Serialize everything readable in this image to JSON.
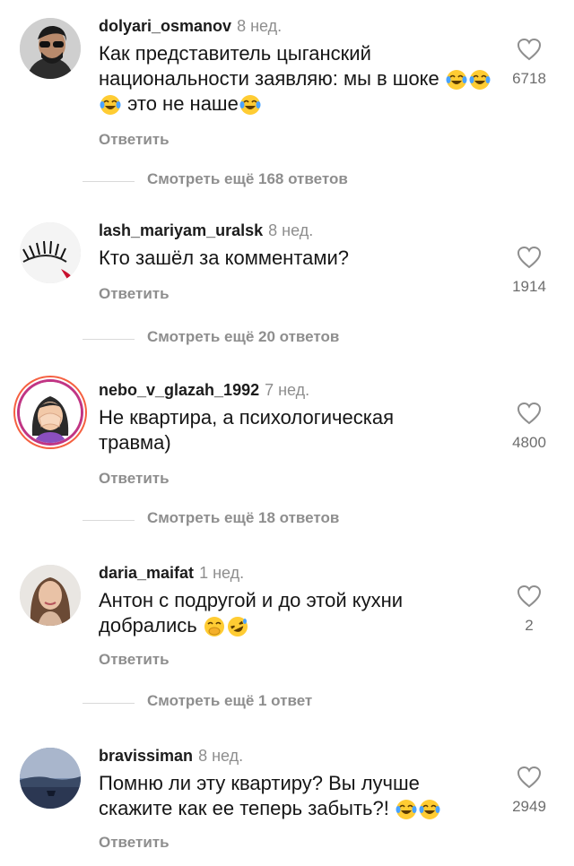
{
  "comments": [
    {
      "username": "dolyari_osmanov",
      "time": "8 нед.",
      "text": "Как представитель цыганский национальности заявляю: мы в шоке 😂😂😂 это не наше😂",
      "reply_label": "Ответить",
      "likes": "6718",
      "more_replies": "Смотреть ещё 168 ответов",
      "avatar_icon": "man-avatar"
    },
    {
      "username": "lash_mariyam_uralsk",
      "time": "8 нед.",
      "text": "Кто зашёл за комментами?",
      "reply_label": "Ответить",
      "likes": "1914",
      "more_replies": "Смотреть ещё 20 ответов",
      "avatar_icon": "eyelash-avatar"
    },
    {
      "username": "nebo_v_glazah_1992",
      "time": "7 нед.",
      "text": "Не квартира, а психологическая травма)",
      "reply_label": "Ответить",
      "likes": "4800",
      "more_replies": "Смотреть ещё 18 ответов",
      "avatar_icon": "facepalm-avatar"
    },
    {
      "username": "daria_maifat",
      "time": "1 нед.",
      "text": "Антон  с подругой и до этой кухни добрались 🤭🤣",
      "reply_label": "Ответить",
      "likes": "2",
      "more_replies": "Смотреть ещё 1 ответ",
      "avatar_icon": "woman-avatar"
    },
    {
      "username": "bravissiman",
      "time": "8 нед.",
      "text": "Помню ли эту квартиру? Вы лучше скажите как ее теперь забыть?! 😂😂",
      "reply_label": "Ответить",
      "likes": "2949",
      "avatar_icon": "landscape-avatar"
    }
  ],
  "icons": {
    "like": "heart-outline-icon"
  },
  "colors": {
    "meta": "#8e8e8e",
    "text": "#161616",
    "username": "#1c1c1c",
    "divider": "#d9d9d9"
  }
}
